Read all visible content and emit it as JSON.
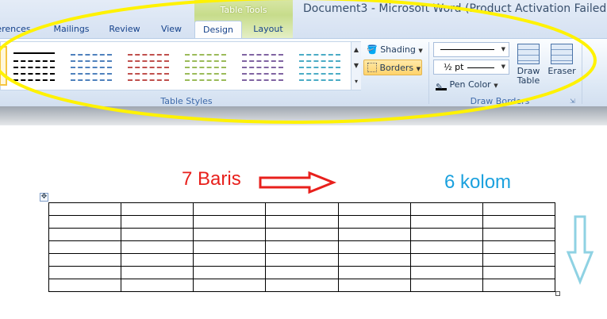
{
  "tabs": [
    "erences",
    "Mailings",
    "Review",
    "View",
    "Design",
    "Layout"
  ],
  "contextual_group": "Table Tools",
  "window_title": "Document3 - Microsoft Word (Product Activation Failed)",
  "ribbon": {
    "shading_label": "Shading",
    "borders_label": "Borders",
    "pen_weight": "½ pt",
    "pen_color_label": "Pen Color",
    "draw_table_line1": "Draw",
    "draw_table_line2": "Table",
    "eraser_label": "Eraser",
    "group_table_styles": "Table Styles",
    "group_draw_borders": "Draw Borders"
  },
  "style_colors": [
    "#000000",
    "#4f81bd",
    "#c0504d",
    "#9bbb59",
    "#8064a2",
    "#4bacc6"
  ],
  "annotations": {
    "rows_label": "7 Baris",
    "columns_label": "6 kolom",
    "highlight_color": "#fff200",
    "rows_color": "#e8201c",
    "columns_color": "#1ba1de"
  },
  "table": {
    "rows": 7,
    "columns": 7
  }
}
